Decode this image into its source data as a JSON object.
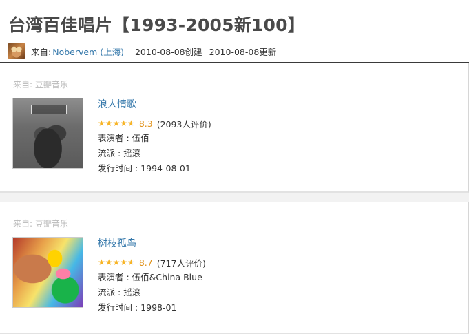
{
  "page": {
    "title": "台湾百佳唱片【1993-2005新100】",
    "meta": {
      "from_label": "来自:",
      "user": "Nobervem (上海)",
      "created": "2010-08-08创建",
      "updated": "2010-08-08更新"
    }
  },
  "items": [
    {
      "source": "来自:  豆瓣音乐",
      "title": "浪人情歌",
      "stars": 4.5,
      "score": "8.3",
      "votes": "(2093人评价)",
      "performer_label": "表演者 :",
      "performer": "伍佰",
      "genre_label": "流派 :",
      "genre": "摇滚",
      "release_label": "发行时间 :",
      "release": "1994-08-01"
    },
    {
      "source": "来自:  豆瓣音乐",
      "title": "树枝孤鸟",
      "stars": 4.5,
      "score": "8.7",
      "votes": "(717人评价)",
      "performer_label": "表演者 :",
      "performer": "伍佰&China Blue",
      "genre_label": "流派 :",
      "genre": "摇滚",
      "release_label": "发行时间 :",
      "release": "1998-01"
    }
  ],
  "colors": {
    "link": "#3377aa",
    "star": "#f7b426",
    "score": "#e09015",
    "source": "#b9b9b9"
  }
}
